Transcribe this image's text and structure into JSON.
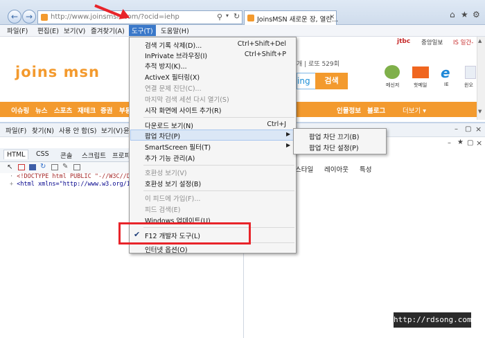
{
  "browser": {
    "address": "http://www.joinsmsn.com/?ocid=iehp",
    "tab_title": "JoinsMSN 새로운 장, 열린...",
    "tab_close": "×"
  },
  "menubar": {
    "items": [
      "파일(F)",
      "편집(E)",
      "보기(V)",
      "즐겨찾기(A)",
      "도구(T)",
      "도움말(H)"
    ]
  },
  "page": {
    "logo": "joins msn",
    "brands": [
      "jtbc",
      "중앙일보",
      "IS 일간-"
    ],
    "info_text": "개  |  로또 529회",
    "search_engine": "ing",
    "search_button": "검색",
    "icon_labels": [
      "메신저",
      "핫메일",
      "IE",
      "윈오"
    ],
    "nav": [
      "이슈링",
      "뉴스",
      "스포츠",
      "재테크",
      "증권",
      "부동"
    ],
    "nav_right": [
      "인물정보",
      "블로그",
      "더보기 ▾"
    ]
  },
  "devtools": {
    "menu": [
      "파일(F)",
      "찾기(N)",
      "사용 안 함(S)",
      "보기(V)",
      "윤"
    ],
    "tabs": [
      "HTML",
      "CSS",
      "콘솔",
      "스크립트",
      "프로파"
    ],
    "code_lines": [
      "<!DOCTYPE html PUBLIC \"-//W3C//DTD X",
      "<html xmlns=\"http://www.w3.org/1999/x"
    ],
    "right_tabs": [
      "스타일",
      "레이아웃",
      "특성"
    ]
  },
  "dropdown": {
    "items": [
      {
        "label": "검색 기록 삭제(D)...",
        "shortcut": "Ctrl+Shift+Del"
      },
      {
        "label": "InPrivate 브라우징(I)",
        "shortcut": "Ctrl+Shift+P"
      },
      {
        "label": "추적 방지(K)..."
      },
      {
        "label": "ActiveX 필터링(X)"
      },
      {
        "label": "연결 문제 진단(C)..."
      },
      {
        "label": "마지막 검색 세션 다시 열기(S)"
      },
      {
        "label": "시작 화면에 사이트 추가(R)"
      },
      {
        "label": "다운로드 보기(N)",
        "shortcut": "Ctrl+J"
      },
      {
        "label": "팝업 차단(P)"
      },
      {
        "label": "SmartScreen 필터(T)"
      },
      {
        "label": "추가 기능 관리(A)"
      },
      {
        "label": "호환성 보기(V)"
      },
      {
        "label": "호환성 보기 설정(B)"
      },
      {
        "label": "이 피드에 가입(F)..."
      },
      {
        "label": "피드 검색(E)"
      },
      {
        "label": "Windows 업데이트(U)"
      },
      {
        "label": "F12 개발자 도구(L)"
      },
      {
        "label": "인터넷 옵션(O)"
      }
    ]
  },
  "submenu": {
    "items": [
      "팝업 차단 끄기(B)",
      "팝업 차단 설정(P)"
    ]
  },
  "watermark": "http://rdsong.com"
}
